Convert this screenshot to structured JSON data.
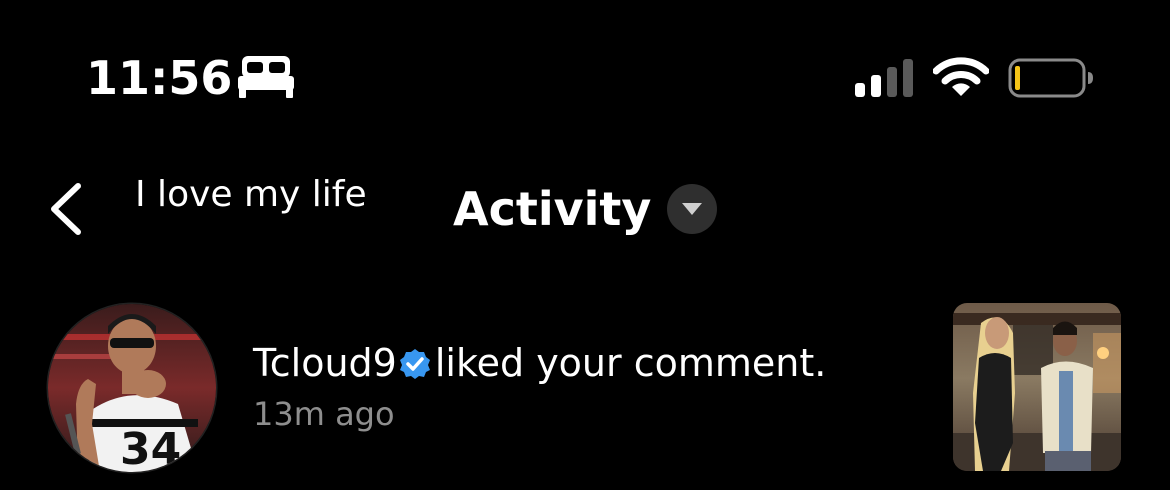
{
  "status_bar": {
    "time": "11:56",
    "focus_icon": "bed-icon",
    "signal_icon": "cellular-signal-icon",
    "wifi_icon": "wifi-icon",
    "battery_icon": "battery-icon",
    "battery_level": 0.08,
    "battery_color": "#f5c518"
  },
  "header": {
    "back_icon": "chevron-left-icon",
    "story_text": "I love my life",
    "title": "Activity",
    "dropdown_icon": "caret-down-icon"
  },
  "notification": {
    "username": "Tcloud9",
    "verified_icon": "verified-badge-icon",
    "verified_color": "#3897f0",
    "action": "liked your comment.",
    "time": "13m ago"
  }
}
